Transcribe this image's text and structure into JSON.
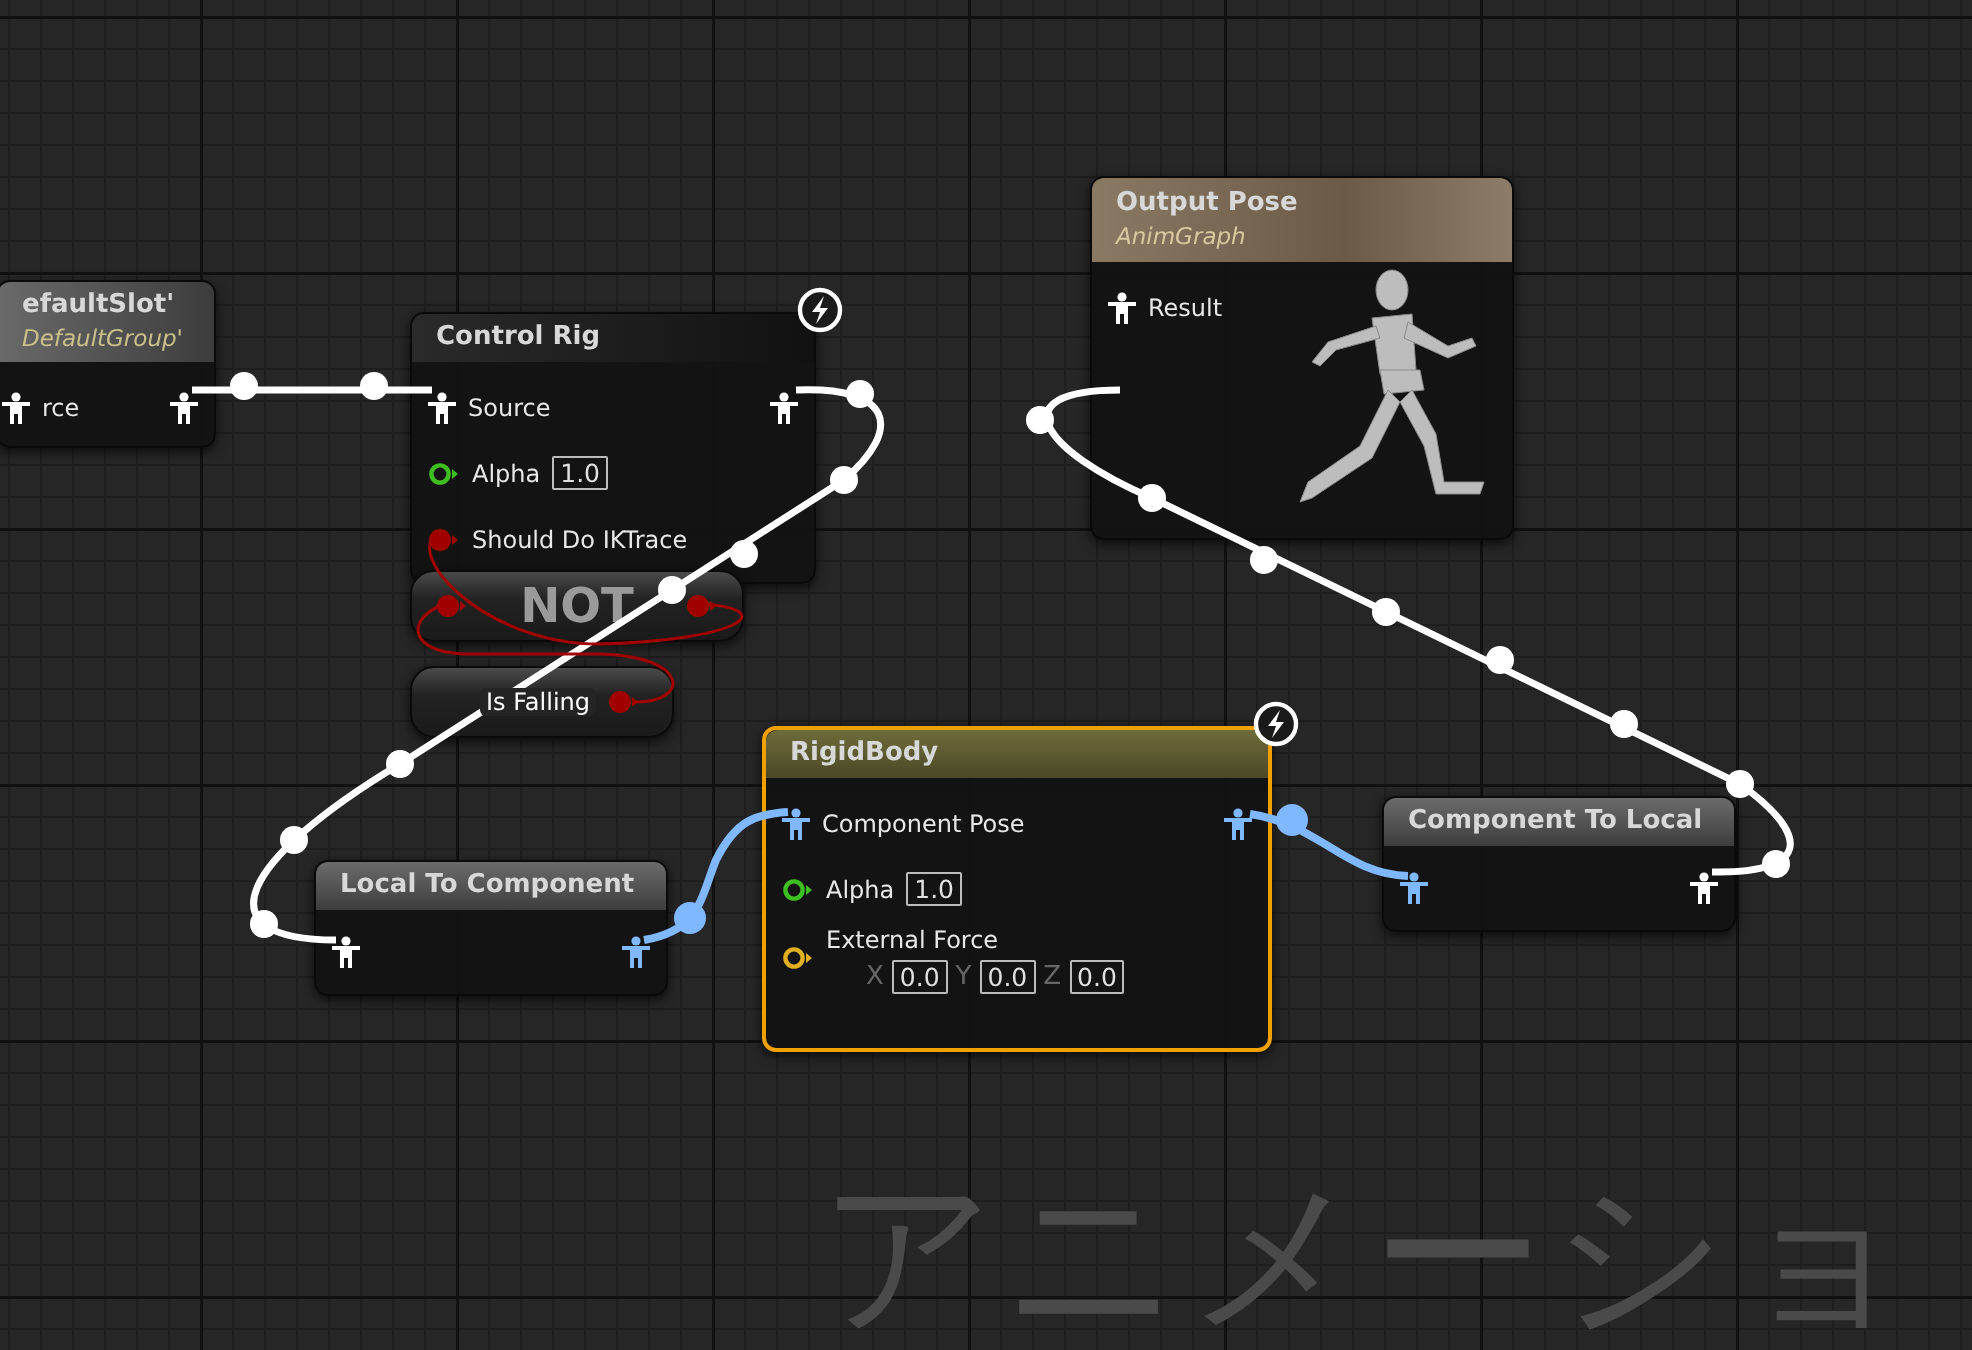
{
  "graph_label": "アニメーショ",
  "nodes": [
    {
      "kind": "slot",
      "title": "efaultSlot'",
      "subtitle": "DefaultGroup'",
      "selected": false,
      "fast_path": false,
      "inputs": [
        {
          "kind": "pose",
          "label": "rce"
        }
      ],
      "outputs": [
        {
          "kind": "pose"
        }
      ]
    },
    {
      "kind": "control_rig",
      "title": "Control Rig",
      "selected": false,
      "fast_path": true,
      "inputs": [
        {
          "kind": "pose",
          "label": "Source"
        },
        {
          "kind": "float",
          "label": "Alpha",
          "value": "1.0"
        },
        {
          "kind": "bool",
          "label": "Should Do IKTrace"
        }
      ],
      "outputs": [
        {
          "kind": "pose"
        }
      ]
    },
    {
      "kind": "compact",
      "title": "NOT",
      "selected": false,
      "fast_path": false,
      "inputs": [
        {
          "kind": "bool"
        }
      ],
      "outputs": [
        {
          "kind": "bool"
        }
      ]
    },
    {
      "kind": "variable",
      "title": "Is Falling",
      "selected": false,
      "fast_path": false,
      "outputs": [
        {
          "kind": "bool"
        }
      ]
    },
    {
      "kind": "anim",
      "title": "Local To Component",
      "selected": false,
      "fast_path": false,
      "inputs": [
        {
          "kind": "pose"
        }
      ],
      "outputs": [
        {
          "kind": "component_pose"
        }
      ]
    },
    {
      "kind": "skeletal_control",
      "title": "RigidBody",
      "selected": true,
      "fast_path": true,
      "inputs": [
        {
          "kind": "component_pose",
          "label": "Component Pose"
        },
        {
          "kind": "float",
          "label": "Alpha",
          "value": "1.0"
        },
        {
          "kind": "vector",
          "label": "External Force",
          "components": [
            {
              "axis": "X",
              "value": "0.0"
            },
            {
              "axis": "Y",
              "value": "0.0"
            },
            {
              "axis": "Z",
              "value": "0.0"
            }
          ]
        }
      ],
      "outputs": [
        {
          "kind": "component_pose"
        }
      ]
    },
    {
      "kind": "anim",
      "title": "Component To Local",
      "selected": false,
      "fast_path": false,
      "inputs": [
        {
          "kind": "component_pose"
        }
      ],
      "outputs": [
        {
          "kind": "pose"
        }
      ]
    },
    {
      "kind": "result",
      "title": "Output Pose",
      "subtitle": "AnimGraph",
      "selected": false,
      "fast_path": false,
      "inputs": [
        {
          "kind": "pose",
          "label": "Result"
        }
      ]
    }
  ]
}
